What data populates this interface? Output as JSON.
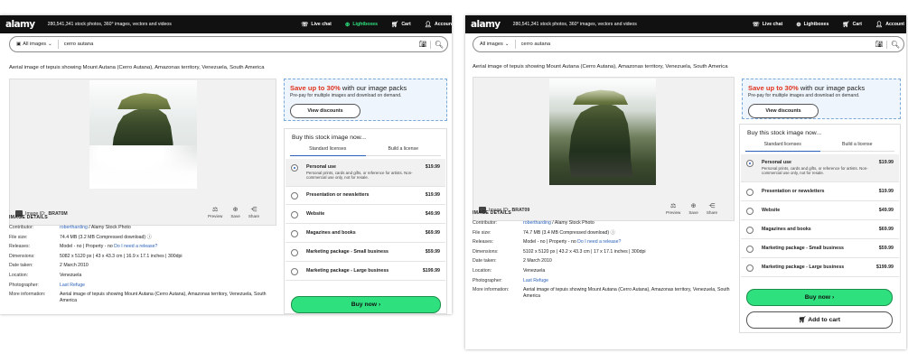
{
  "brand": {
    "logo": "alamy",
    "tagline": "280,541,341 stock photos, 360° images, vectors and videos",
    "accent": "#2fe07e",
    "promo_red": "#e0341f",
    "link": "#2a60b8"
  },
  "left": {
    "nav": {
      "live_chat": "Live chat",
      "lightboxes": "Lightboxes",
      "cart": "Cart",
      "account": "Accoun"
    },
    "search": {
      "category": "All images",
      "query": "cerro autana"
    },
    "caption": "Aerial image of tepuis showing Mount Autana (Cerro Autana), Amazonas territory, Venezuela, South America",
    "image_id_label": "Image ID:",
    "image_id": "BRAT0M",
    "actions": {
      "preview": "Preview",
      "save": "Save",
      "share": "Share"
    },
    "details": {
      "heading": "IMAGE DETAILS",
      "rows": [
        {
          "label": "Contributor:",
          "value": "",
          "link": "robertharding",
          "value_after": " / Alamy Stock Photo"
        },
        {
          "label": "File size:",
          "value": "74.4 MB (3.2 MB Compressed download)",
          "link": "",
          "value_after": " ⓘ"
        },
        {
          "label": "Releases:",
          "value": "Model - no | Property - no   ",
          "link": "Do I need a release?",
          "value_after": ""
        },
        {
          "label": "Dimensions:",
          "value": "5082 x 5120 px | 43 x 43.3 cm | 16.9 x 17.1 inches | 300dpi",
          "link": "",
          "value_after": ""
        },
        {
          "label": "Date taken:",
          "value": "2 March 2010",
          "link": "",
          "value_after": ""
        },
        {
          "label": "Location:",
          "value": "Venezuela",
          "link": "",
          "value_after": ""
        },
        {
          "label": "Photographer:",
          "value": "",
          "link": "Last Refuge",
          "value_after": ""
        },
        {
          "label": "More information:",
          "value": "Aerial image of tepuis showing Mount Autana (Cerro Autana), Amazonas territory, Venezuela, South America",
          "link": "",
          "value_after": ""
        }
      ]
    }
  },
  "right": {
    "nav": {
      "live_chat": "Live chat",
      "lightboxes": "Lightboxes",
      "cart": "Cart",
      "account": "Account"
    },
    "search": {
      "category": "All images",
      "query": "cerro autana"
    },
    "caption": "Aerial image of tepuis showing Mount Autana (Cerro Autana), Amazonas territory, Venezuela, South America",
    "image_id_label": "Image ID:",
    "image_id": "BRAT09",
    "actions": {
      "preview": "Preview",
      "save": "Save",
      "share": "Share"
    },
    "details": {
      "heading": "IMAGE DETAILS",
      "rows": [
        {
          "label": "Contributor:",
          "value": "",
          "link": "robertharding",
          "value_after": " / Alamy Stock Photo"
        },
        {
          "label": "File size:",
          "value": "74.7 MB (3.4 MB Compressed download)",
          "link": "",
          "value_after": " ⓘ"
        },
        {
          "label": "Releases:",
          "value": "Model - no | Property - no   ",
          "link": "Do I need a release?",
          "value_after": ""
        },
        {
          "label": "Dimensions:",
          "value": "5102 x 5120 px | 43.2 x 43.3 cm | 17 x 17.1 inches | 300dpi",
          "link": "",
          "value_after": ""
        },
        {
          "label": "Date taken:",
          "value": "2 March 2010",
          "link": "",
          "value_after": ""
        },
        {
          "label": "Location:",
          "value": "Venezuela",
          "link": "",
          "value_after": ""
        },
        {
          "label": "Photographer:",
          "value": "",
          "link": "Last Refuge",
          "value_after": ""
        },
        {
          "label": "More information:",
          "value": "Aerial image of tepuis showing Mount Autana (Cerro Autana), Amazonas territory, Venezuela, South America",
          "link": "",
          "value_after": ""
        }
      ]
    },
    "add_to_cart": "Add to cart"
  },
  "promo": {
    "highlight": "Save up to 30%",
    "rest": " with our image packs",
    "sub": "Pre-pay for multiple images and download on demand.",
    "button": "View discounts"
  },
  "buy": {
    "title": "Buy this stock image now...",
    "tabs": [
      "Standard licenses",
      "Build a license"
    ],
    "licenses": [
      {
        "name": "Personal use",
        "desc": "Personal prints, cards and gifts, or reference for artists. Non-commercial use only, not for resale.",
        "price": "$19.99",
        "selected": true
      },
      {
        "name": "Presentation or newsletters",
        "desc": "",
        "price": "$19.99",
        "selected": false
      },
      {
        "name": "Website",
        "desc": "",
        "price": "$49.99",
        "selected": false
      },
      {
        "name": "Magazines and books",
        "desc": "",
        "price": "$69.99",
        "selected": false
      },
      {
        "name": "Marketing package - Small business",
        "desc": "",
        "price": "$59.99",
        "selected": false
      },
      {
        "name": "Marketing package - Large business",
        "desc": "",
        "price": "$199.99",
        "selected": false
      }
    ],
    "buy_now": "Buy now ›"
  }
}
